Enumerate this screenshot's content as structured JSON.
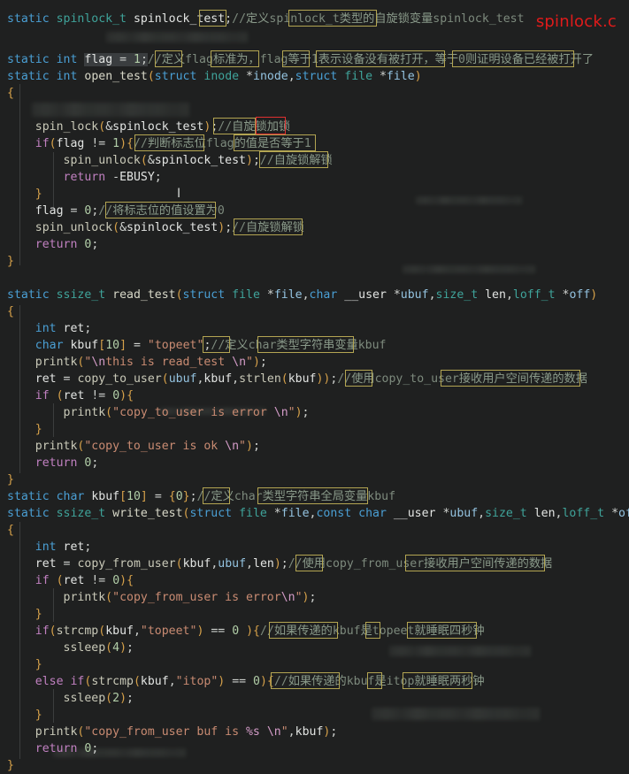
{
  "window": {
    "filename_label": "spinlock.c",
    "filename_color": "#e01b1b",
    "background_color": "#1f2020"
  },
  "theme": {
    "keyword_color": "#4a9fd4",
    "type_color": "#3fa39a",
    "comment_color": "#7d8a7d",
    "string_color": "#c98b72",
    "number_color": "#b2cea8",
    "control_color": "#c080c0",
    "annotation_box_color": "#b3a552",
    "highlight_box_color": "#e03030",
    "selection_color": "#3a3d3f"
  },
  "code": {
    "lines": [
      {
        "n": 1,
        "indent": 0,
        "text": "static spinlock_t spinlock_test;//定义spinlock_t类型的自旋锁变量spinlock_test"
      },
      {
        "n": 2,
        "indent": 0,
        "text": ""
      },
      {
        "n": 3,
        "indent": 0,
        "text": ""
      },
      {
        "n": 4,
        "indent": 0,
        "text": "static int flag = 1;//定义flag标准为，flag等于1表示设备没有被打开，等于0则证明设备已经被打开了"
      },
      {
        "n": 5,
        "indent": 0,
        "text": "static int open_test(struct inode *inode,struct file *file)"
      },
      {
        "n": 6,
        "indent": 0,
        "text": "{"
      },
      {
        "n": 7,
        "indent": 1,
        "text": ""
      },
      {
        "n": 8,
        "indent": 1,
        "text": "spin_lock(&spinlock_test);//自旋锁加锁"
      },
      {
        "n": 9,
        "indent": 1,
        "text": "if(flag != 1){//判断标志位flag的值是否等于1"
      },
      {
        "n": 10,
        "indent": 2,
        "text": "spin_unlock(&spinlock_test);//自旋锁解锁"
      },
      {
        "n": 11,
        "indent": 2,
        "text": "return -EBUSY;"
      },
      {
        "n": 12,
        "indent": 1,
        "text": "}"
      },
      {
        "n": 13,
        "indent": 1,
        "text": "flag = 0;//将标志位的值设置为0"
      },
      {
        "n": 14,
        "indent": 1,
        "text": "spin_unlock(&spinlock_test);//自旋锁解锁"
      },
      {
        "n": 15,
        "indent": 1,
        "text": "return 0;"
      },
      {
        "n": 16,
        "indent": 0,
        "text": "}"
      },
      {
        "n": 17,
        "indent": 0,
        "text": ""
      },
      {
        "n": 18,
        "indent": 0,
        "text": "static ssize_t read_test(struct file *file,char __user *ubuf,size_t len,loff_t *off)"
      },
      {
        "n": 19,
        "indent": 0,
        "text": "{"
      },
      {
        "n": 20,
        "indent": 1,
        "text": "int ret;"
      },
      {
        "n": 21,
        "indent": 1,
        "text": "char kbuf[10] = \"topeet\";//定义char类型字符串变量kbuf"
      },
      {
        "n": 22,
        "indent": 1,
        "text": "printk(\"\\nthis is read_test \\n\");"
      },
      {
        "n": 23,
        "indent": 1,
        "text": "ret = copy_to_user(ubuf,kbuf,strlen(kbuf));//使用copy_to_user接收用户空间传递的数据"
      },
      {
        "n": 24,
        "indent": 1,
        "text": "if (ret != 0){"
      },
      {
        "n": 25,
        "indent": 2,
        "text": "printk(\"copy_to_user is error \\n\");"
      },
      {
        "n": 26,
        "indent": 1,
        "text": "}"
      },
      {
        "n": 27,
        "indent": 1,
        "text": "printk(\"copy_to_user is ok \\n\");"
      },
      {
        "n": 28,
        "indent": 1,
        "text": "return 0;"
      },
      {
        "n": 29,
        "indent": 0,
        "text": "}"
      },
      {
        "n": 30,
        "indent": 0,
        "text": "static char kbuf[10] = {0};//定义char类型字符串全局变量kbuf"
      },
      {
        "n": 31,
        "indent": 0,
        "text": "static ssize_t write_test(struct file *file,const char __user *ubuf,size_t len,loff_t *off)"
      },
      {
        "n": 32,
        "indent": 0,
        "text": "{"
      },
      {
        "n": 33,
        "indent": 1,
        "text": "int ret;"
      },
      {
        "n": 34,
        "indent": 1,
        "text": "ret = copy_from_user(kbuf,ubuf,len);//使用copy_from_user接收用户空间传递的数据"
      },
      {
        "n": 35,
        "indent": 1,
        "text": "if (ret != 0){"
      },
      {
        "n": 36,
        "indent": 2,
        "text": "printk(\"copy_from_user is error\\n\");"
      },
      {
        "n": 37,
        "indent": 1,
        "text": "}"
      },
      {
        "n": 38,
        "indent": 1,
        "text": "if(strcmp(kbuf,\"topeet\") == 0 ){//如果传递的kbuf是topeet就睡眠四秒钟"
      },
      {
        "n": 39,
        "indent": 2,
        "text": "ssleep(4);"
      },
      {
        "n": 40,
        "indent": 1,
        "text": "}"
      },
      {
        "n": 41,
        "indent": 1,
        "text": "else if(strcmp(kbuf,\"itop\") == 0){//如果传递的kbuf是itop就睡眠两秒钟"
      },
      {
        "n": 42,
        "indent": 2,
        "text": "ssleep(2);"
      },
      {
        "n": 43,
        "indent": 1,
        "text": "}"
      },
      {
        "n": 44,
        "indent": 1,
        "text": "printk(\"copy_from_user buf is %s \\n\",kbuf);"
      },
      {
        "n": 45,
        "indent": 1,
        "text": "return 0;"
      },
      {
        "n": 46,
        "indent": 0,
        "text": "}"
      }
    ]
  },
  "annotations": [
    {
      "id": 1,
      "text": "定义",
      "style": "olive"
    },
    {
      "id": 2,
      "text": "类型的自旋锁变量",
      "style": "olive"
    },
    {
      "id": 3,
      "text": "定义",
      "style": "olive"
    },
    {
      "id": 4,
      "text": "标准为，",
      "style": "olive"
    },
    {
      "id": 5,
      "text": "等于",
      "style": "olive"
    },
    {
      "id": 6,
      "text": "表示设备没有被打开，等于",
      "style": "olive"
    },
    {
      "id": 7,
      "text": "则证明设备已经被打开了",
      "style": "olive"
    },
    {
      "id": 8,
      "text": "自旋锁",
      "style": "olive"
    },
    {
      "id": 9,
      "text": "加锁",
      "style": "red"
    },
    {
      "id": 10,
      "text": "判断标志位",
      "style": "olive"
    },
    {
      "id": 11,
      "text": "的值是否等于",
      "style": "olive"
    },
    {
      "id": 12,
      "text": "自旋锁解锁",
      "style": "olive"
    },
    {
      "id": 13,
      "text": "将标志位的值设置为",
      "style": "olive"
    },
    {
      "id": 14,
      "text": "自旋锁解锁",
      "style": "olive"
    },
    {
      "id": 15,
      "text": "定义",
      "style": "olive"
    },
    {
      "id": 16,
      "text": "类型字符串变量",
      "style": "olive"
    },
    {
      "id": 17,
      "text": "使用",
      "style": "olive"
    },
    {
      "id": 18,
      "text": "接收用户空间传递的数据",
      "style": "olive"
    },
    {
      "id": 19,
      "text": "定义",
      "style": "olive"
    },
    {
      "id": 20,
      "text": "类型字符串全局变量",
      "style": "olive"
    },
    {
      "id": 21,
      "text": "使用",
      "style": "olive"
    },
    {
      "id": 22,
      "text": "接收用户空间传递的数据",
      "style": "olive"
    },
    {
      "id": 23,
      "text": "如果传递的",
      "style": "olive"
    },
    {
      "id": 24,
      "text": "是",
      "style": "olive"
    },
    {
      "id": 25,
      "text": "就睡眠四秒钟",
      "style": "olive"
    },
    {
      "id": 26,
      "text": "如果传递的",
      "style": "olive"
    },
    {
      "id": 27,
      "text": "是",
      "style": "olive"
    },
    {
      "id": 28,
      "text": "就睡眠两秒钟",
      "style": "olive"
    }
  ]
}
